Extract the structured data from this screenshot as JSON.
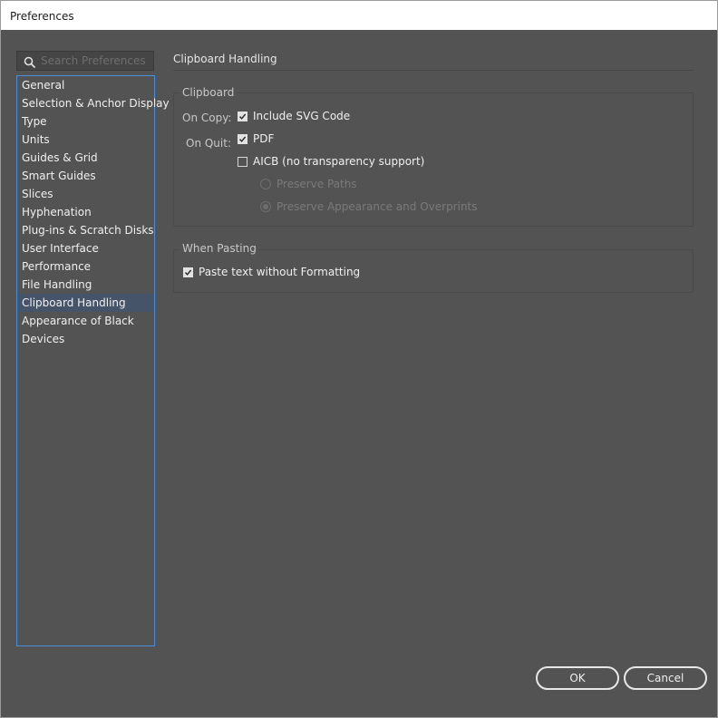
{
  "window": {
    "title": "Preferences"
  },
  "search": {
    "placeholder": "Search Preferences",
    "value": ""
  },
  "sidebar": {
    "items": [
      {
        "label": "General",
        "selected": false
      },
      {
        "label": "Selection & Anchor Display",
        "selected": false
      },
      {
        "label": "Type",
        "selected": false
      },
      {
        "label": "Units",
        "selected": false
      },
      {
        "label": "Guides & Grid",
        "selected": false
      },
      {
        "label": "Smart Guides",
        "selected": false
      },
      {
        "label": "Slices",
        "selected": false
      },
      {
        "label": "Hyphenation",
        "selected": false
      },
      {
        "label": "Plug-ins & Scratch Disks",
        "selected": false
      },
      {
        "label": "User Interface",
        "selected": false
      },
      {
        "label": "Performance",
        "selected": false
      },
      {
        "label": "File Handling",
        "selected": false
      },
      {
        "label": "Clipboard Handling",
        "selected": true
      },
      {
        "label": "Appearance of Black",
        "selected": false
      },
      {
        "label": "Devices",
        "selected": false
      }
    ]
  },
  "panel": {
    "heading": "Clipboard Handling",
    "clipboard": {
      "group_label": "Clipboard",
      "on_copy_label": "On Copy:",
      "on_quit_label": "On Quit:",
      "include_svg": {
        "label": "Include SVG Code",
        "checked": true
      },
      "pdf": {
        "label": "PDF",
        "checked": true
      },
      "aicb": {
        "label": "AICB (no transparency support)",
        "checked": false
      },
      "preserve_paths": {
        "label": "Preserve Paths",
        "selected": false,
        "enabled": false
      },
      "preserve_appearance": {
        "label": "Preserve Appearance and Overprints",
        "selected": true,
        "enabled": false
      }
    },
    "pasting": {
      "group_label": "When Pasting",
      "paste_text": {
        "label": "Paste text without Formatting",
        "checked": true
      }
    }
  },
  "buttons": {
    "ok": "OK",
    "cancel": "Cancel"
  },
  "colors": {
    "background": "#535353",
    "selection": "#46546a",
    "focus_border": "#4a8fd9",
    "titlebar": "#ffffff"
  },
  "icons": {
    "search": "search-icon",
    "check": "checkmark-icon"
  }
}
